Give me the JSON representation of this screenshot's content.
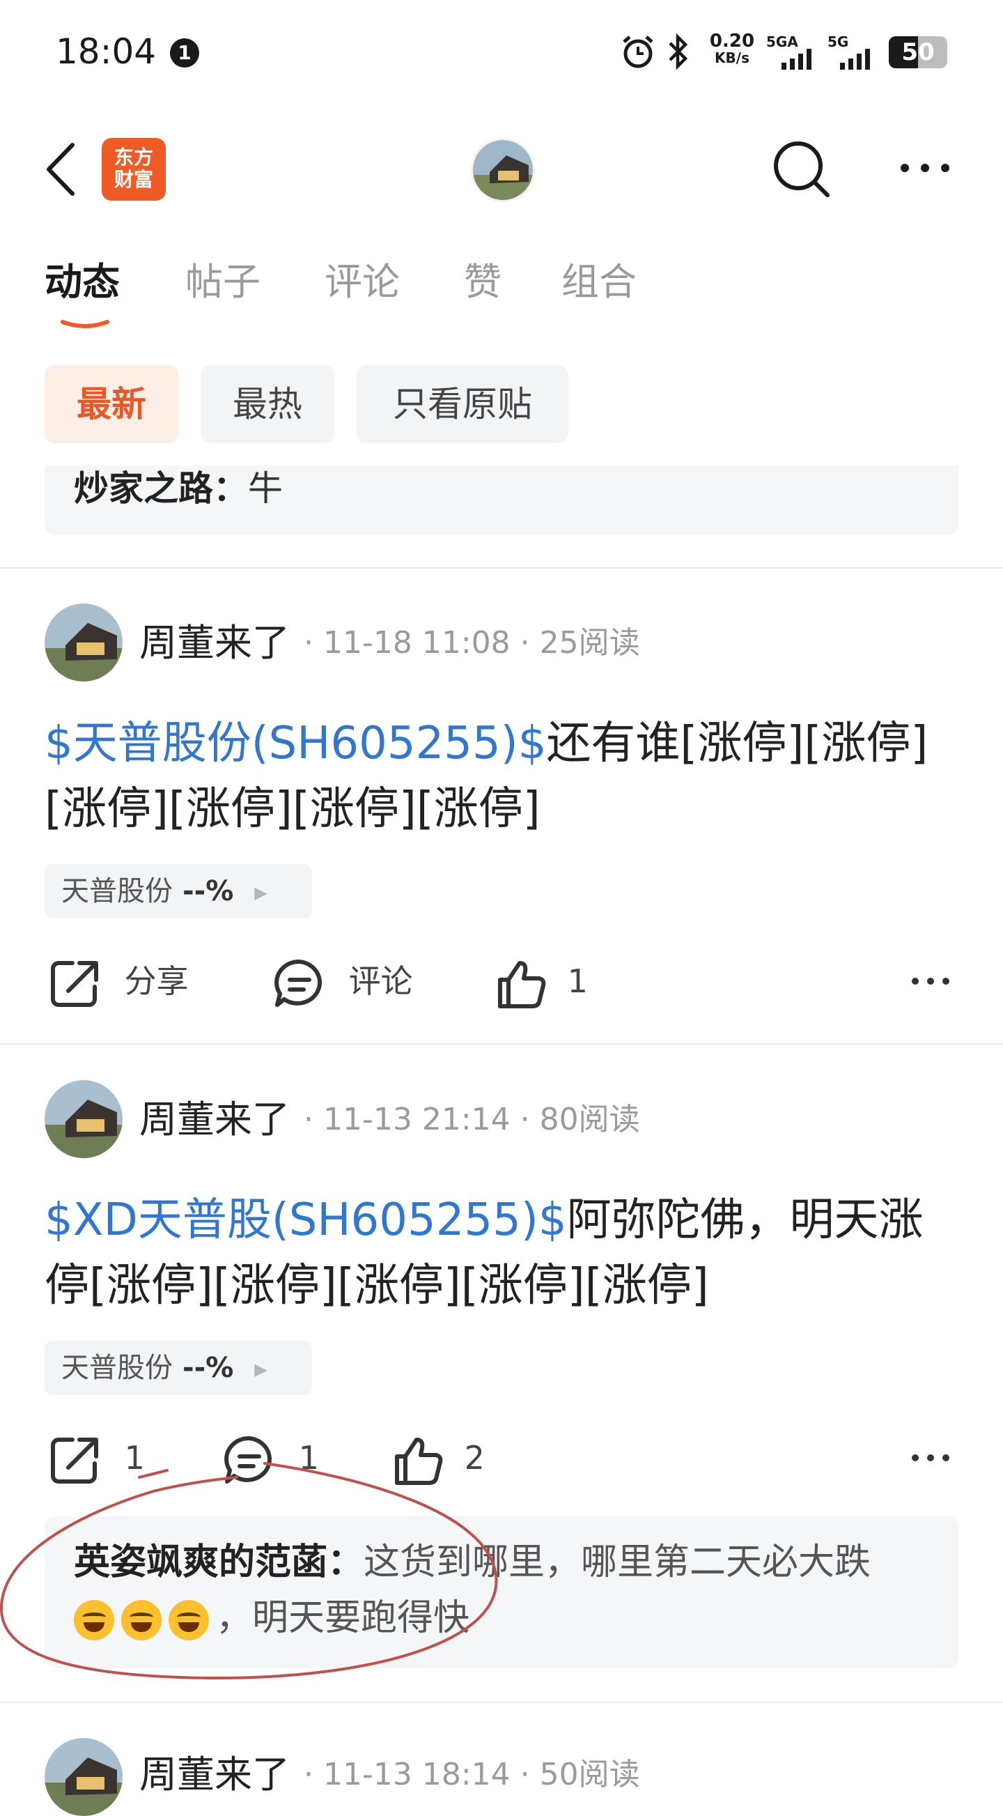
{
  "status_bar": {
    "time": "18:04",
    "notification_count": "1",
    "speed_value": "0.20",
    "speed_unit": "KB/s",
    "network_1": "5GA",
    "network_2": "5G",
    "battery": "50"
  },
  "header": {
    "logo_line1": "东方",
    "logo_line2": "财富"
  },
  "tabs": [
    {
      "label": "动态",
      "active": true
    },
    {
      "label": "帖子",
      "active": false
    },
    {
      "label": "评论",
      "active": false
    },
    {
      "label": "赞",
      "active": false
    },
    {
      "label": "组合",
      "active": false
    }
  ],
  "filters": [
    {
      "label": "最新",
      "active": true
    },
    {
      "label": "最热",
      "active": false
    },
    {
      "label": "只看原贴",
      "active": false
    }
  ],
  "top_quote": {
    "author": "炒家之路：",
    "text": "牛"
  },
  "posts": [
    {
      "author": "周董来了",
      "date": "11-18 11:08",
      "reads": "25阅读",
      "link": "$天普股份(SH605255)$",
      "text_line1": "还有谁[涨停][涨停]",
      "text_line2": "[涨停][涨停][涨停][涨停]",
      "stock_name": "天普股份",
      "stock_change": "--%",
      "share": "分享",
      "comment": "评论",
      "likes": "1"
    },
    {
      "author": "周董来了",
      "date": "11-13 21:14",
      "reads": "80阅读",
      "link": "$XD天普股(SH605255)$",
      "text_line1": "阿弥陀佛，明天涨",
      "text_line2": "停[涨停][涨停][涨停][涨停][涨停]",
      "stock_name": "天普股份",
      "stock_change": "--%",
      "share": "1",
      "comment": "1",
      "likes": "2",
      "reply_author": "英姿飒爽的范菡：",
      "reply_text1": "这货到哪里，哪里第二天必大跌",
      "reply_text2": "，明天要跑得快"
    },
    {
      "author": "周董来了",
      "date": "11-13 18:14",
      "reads": "50阅读"
    }
  ],
  "meta_separator": "·",
  "colors": {
    "accent": "#f05a24",
    "link": "#2f77d1",
    "annotation": "#c0504d"
  }
}
